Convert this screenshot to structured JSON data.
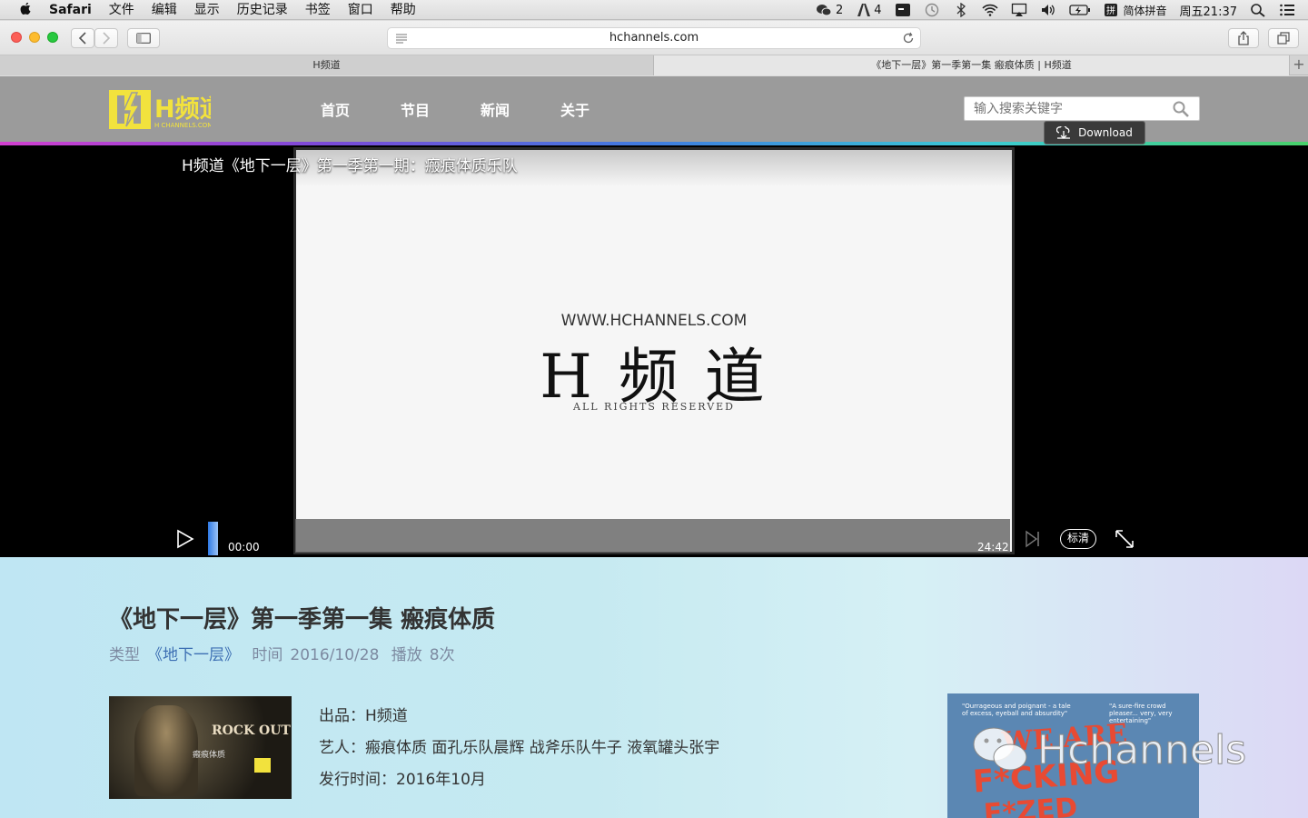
{
  "menubar": {
    "app": "Safari",
    "items": [
      "文件",
      "编辑",
      "显示",
      "历史记录",
      "书签",
      "窗口",
      "帮助"
    ],
    "wechat_count": "2",
    "adobe_count": "4",
    "input_method": "简体拼音",
    "clock": "周五21:37"
  },
  "browser": {
    "url": "hchannels.com",
    "tabs": [
      {
        "label": "H频道"
      },
      {
        "label": "《地下一层》第一季第一集 瘢痕体质 | H频道"
      }
    ]
  },
  "site": {
    "logo_main": "H频道",
    "logo_sub": "H CHANNELS.COM",
    "nav": [
      "首页",
      "节目",
      "新闻",
      "关于"
    ],
    "search_placeholder": "输入搜索关键字",
    "download_label": "Download"
  },
  "player": {
    "title": "H频道《地下一层》第一季第一期：瘢痕体质乐队",
    "watermark_url": "WWW.HCHANNELS.COM",
    "watermark_name": "H 频 道",
    "watermark_rights": "ALL RIGHTS RESERVED",
    "time_current": "00:00",
    "time_total": "24:42",
    "quality": "标清",
    "progress": 0
  },
  "episode": {
    "title": "《地下一层》第一季第一集 瘢痕体质",
    "meta_type_label": "类型",
    "meta_type_value": "《地下一层》",
    "meta_time_label": "时间",
    "meta_time_value": "2016/10/28",
    "meta_plays_label": "播放",
    "meta_plays_value": "8次",
    "producer": "出品：H频道",
    "artists": "艺人：瘢痕体质 面孔乐队晨辉 战斧乐队牛子 液氧罐头张宇",
    "release": "发行时间：2016年10月",
    "thumb_title": "ROCK OUT",
    "thumb_sub": "瘢痕体质",
    "poster_line1": "WE ARE",
    "poster_line2": "F*CKING",
    "poster_line3": "F*ZED",
    "poster_tag_left": "\"Ourrageous and poignant - a tale of excess, eyeball and absurdity\"",
    "poster_tag_right": "\"A sure-fire crowd pleaser... very, very entertaining\""
  },
  "overlay_watermark": "Hchannels",
  "colors": {
    "header_bg": "#9b9b9b",
    "logo_yellow": "#f2e23d",
    "meta_link": "#3d6fb3"
  }
}
